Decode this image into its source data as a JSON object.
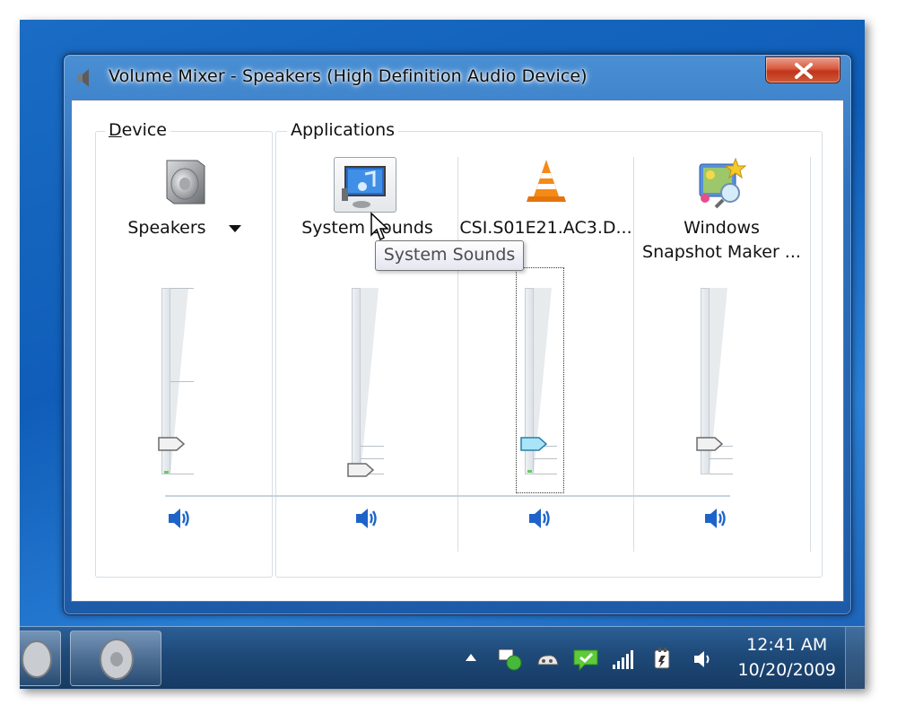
{
  "window": {
    "title": "Volume Mixer - Speakers (High Definition Audio Device)"
  },
  "device_group": {
    "label_underlined": "D",
    "label_rest": "evice",
    "speakers_label": "Speakers"
  },
  "apps_group": {
    "label": "Applications"
  },
  "channels": [
    {
      "name": "Speakers",
      "volume_fraction": 0.21
    },
    {
      "name": "System Sounds",
      "volume_fraction": 0.05
    },
    {
      "name": "CSI.S01E21.AC3.D...",
      "volume_fraction": 0.21
    },
    {
      "name_line1": "Windows",
      "name_line2": "Snapshot Maker ...",
      "volume_fraction": 0.21
    }
  ],
  "tooltip": {
    "text": "System Sounds"
  },
  "clock": {
    "time": "12:41 AM",
    "date": "10/20/2009"
  }
}
